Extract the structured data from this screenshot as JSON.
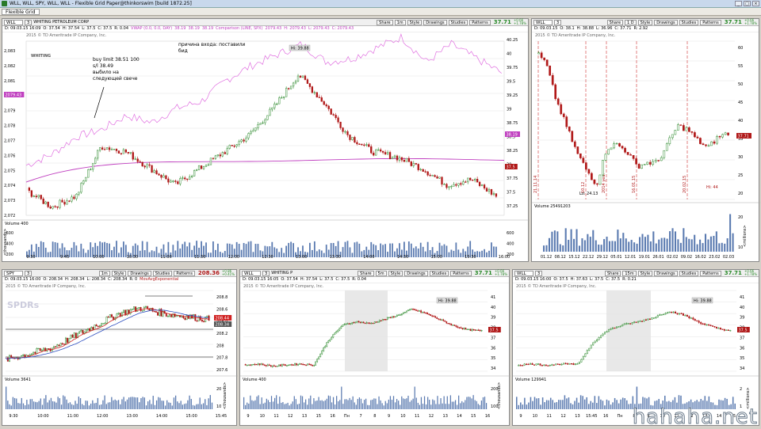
{
  "window": {
    "title": "WLL, WLL, SPY, WLL, WLL - Flexible Grid Paper@thinkorswim [build 1872.25]",
    "tab": "Flexible Grid"
  },
  "colors": {
    "up": "#2d8a2d",
    "down": "#b01818",
    "vwap": "#c040c0",
    "compare": "#e070e0",
    "volume": "#5a7ab0",
    "price_green": "#2a8a2a"
  },
  "buttons": {
    "share": "Share",
    "style": "Style",
    "drawings": "Drawings",
    "studies": "Studies",
    "patterns": "Patterns"
  },
  "panels": [
    {
      "symbol": "WLL",
      "agg": "1 d 1m",
      "agg_btn": "1m",
      "company": "WHITING PETROLEUM CORP",
      "price": "37.71",
      "chg1": "+0.66",
      "chg2": "+1.78%",
      "info": [
        "D: 09.03.15 16:09",
        "O: 37.54",
        "H: 37.54",
        "L: 37.5",
        "C: 37.5",
        "R: 0.04",
        "VWAP (0.0, 0.0, DAY)",
        "38.19",
        "38.19",
        "38.19",
        "Comparison (LINE, SPX)",
        "2079.43",
        "H: 2079.43",
        "L: 2079.43",
        "C: 2079.43"
      ],
      "copyright": "2015 © TD Ameritrade IP Company, Inc.",
      "volume_label": "Volume",
      "volume_value": "400",
      "hi_label": "Hi: 39.88",
      "lo_label": "",
      "price_tag": "37.5",
      "vwap_tag": "38.19",
      "cmp_tag": "2079.43",
      "left_ticks": [
        "2,083",
        "2,082",
        "2,081",
        "2,080",
        "2,079",
        "2,078",
        "2,077",
        "2,076",
        "2,075",
        "2,074",
        "2,073",
        "2,072"
      ],
      "right_ticks": [
        "40.25",
        "40",
        "39.75",
        "39.5",
        "39.25",
        "39",
        "38.75",
        "38.5",
        "38.25",
        "38",
        "37.75",
        "37.5",
        "37.25"
      ],
      "vol_ticks": [
        "600",
        "400",
        "200"
      ],
      "x_ticks": [
        "9:30",
        "9:45",
        "10:00",
        "10:30",
        "11:00",
        "11:30",
        "12:00",
        "12:30",
        "13:00",
        "13:30",
        "14:00",
        "14:30",
        "15:00",
        "15:30",
        "16:00"
      ],
      "vol_axis_label": "<thousands>"
    },
    {
      "symbol": "WLL",
      "agg": "1 Y 1 D",
      "agg_btn": "1 D",
      "company": "",
      "price": "37.71",
      "chg1": "+0.66",
      "chg2": "+1.78%",
      "info": [
        "D: 09.03.15",
        "O: 38.1",
        "H: 38.88",
        "L: 36.96",
        "C: 37.71",
        "R: 2.92"
      ],
      "copyright": "2015 © TD Ameritrade IP Company, Inc.",
      "volume_label": "Volume",
      "volume_value": "25491203",
      "hi_label": "",
      "lo_label": "Lo: 24.13",
      "price_tag": "37.71",
      "vline_labels": [
        "21.11.14",
        "10.12",
        "2014 year",
        "16.01.15",
        "20.02.15"
      ],
      "low_label2": "Hi: 44",
      "right_ticks": [
        "60",
        "55",
        "50",
        "45",
        "40",
        "35",
        "30",
        "25",
        "20"
      ],
      "vol_ticks": [
        "20",
        "10"
      ],
      "x_ticks": [
        "01.12",
        "08.12",
        "15.12",
        "22.12",
        "29.12",
        "05.01",
        "12.01",
        "19.01",
        "26.01",
        "02.02",
        "09.02",
        "16.02",
        "23.02",
        "02.03"
      ],
      "vol_axis_label": "<millions>"
    },
    {
      "symbol": "SPY",
      "agg": "3 d 1m",
      "agg_btn": "1m",
      "company": "",
      "price": "208.36",
      "chg1": "+0.86",
      "chg2": "+0.41%",
      "info": [
        "D: 09.03.15 16:00",
        "O: 208.34",
        "H: 208.34",
        "L: 208.34",
        "C: 208.34",
        "R: 0",
        "MovAvgExponential"
      ],
      "copyright": "2015 © TD Ameritrade IP Company, Inc.",
      "volume_label": "Volume",
      "volume_value": "3641",
      "price_tag": "208.44",
      "price_tag2": "208.34",
      "right_ticks": [
        "208.8",
        "208.6",
        "208.4",
        "208.2",
        "208",
        "207.8",
        "207.6"
      ],
      "vol_ticks": [
        "20",
        "10"
      ],
      "x_ticks": [
        "9:30",
        "10:00",
        "11:00",
        "12:00",
        "13:00",
        "14:00",
        "15:00",
        "15:45"
      ],
      "vol_axis_label": "<thousands>"
    },
    {
      "symbol": "WLL",
      "agg": "5 d 5m",
      "agg_btn": "5m",
      "company": "WHITING P",
      "price": "37.71",
      "chg1": "+0.66",
      "chg2": "+1.78%",
      "info": [
        "D: 09.03.15 16:05",
        "O: 37.54",
        "H: 37.54",
        "L: 37.5",
        "C: 37.5",
        "R: 0.04"
      ],
      "copyright": "2015 © TD Ameritrade IP Company, Inc.",
      "volume_label": "Volume",
      "volume_value": "400",
      "hi_label": "Hi: 39.88",
      "price_tag": "37.5",
      "right_ticks": [
        "41",
        "40",
        "39",
        "38",
        "37",
        "36",
        "35",
        "34"
      ],
      "vol_ticks": [
        "200",
        "100"
      ],
      "x_ticks": [
        "9",
        "10",
        "11",
        "12",
        "13",
        "15",
        "16",
        "Пн",
        "7",
        "8",
        "9",
        "10",
        "11",
        "12",
        "13",
        "14",
        "15",
        "16"
      ],
      "vol_axis_label": "<thousands>"
    },
    {
      "symbol": "WLL",
      "agg": "5 d 15m",
      "agg_btn": "15m",
      "company": "",
      "price": "37.71",
      "chg1": "+0.66",
      "chg2": "+1.78%",
      "info": [
        "D: 09.03.15 16:00",
        "O: 37.5",
        "H: 37.63",
        "L: 37.5",
        "C: 37.5",
        "R: 0.21"
      ],
      "copyright": "2015 © TD Ameritrade IP Company, Inc.",
      "volume_label": "Volume",
      "volume_value": "129941",
      "hi_label": "Hi: 39.88",
      "price_tag": "37.5",
      "right_ticks": [
        "41",
        "40",
        "39",
        "38",
        "37",
        "36",
        "35",
        "34"
      ],
      "vol_ticks": [
        "2",
        "1"
      ],
      "x_ticks": [
        "9",
        "10",
        "11",
        "12",
        "13",
        "15:45",
        "16",
        "Пн",
        "8",
        "9",
        "10",
        "11",
        "12",
        "13",
        "14",
        "15"
      ],
      "vol_axis_label": "<millions>"
    }
  ],
  "annotations": {
    "buy_note": [
      "buy limit 38.51 100",
      "s/l 38.49",
      "выбило на",
      "следующей свече"
    ],
    "reason_note": [
      "причина входа: поставили",
      "бид"
    ]
  },
  "logos": {
    "whiting": "WHITING",
    "spdr": "SPDRs"
  },
  "watermark": "hahaha.net"
}
